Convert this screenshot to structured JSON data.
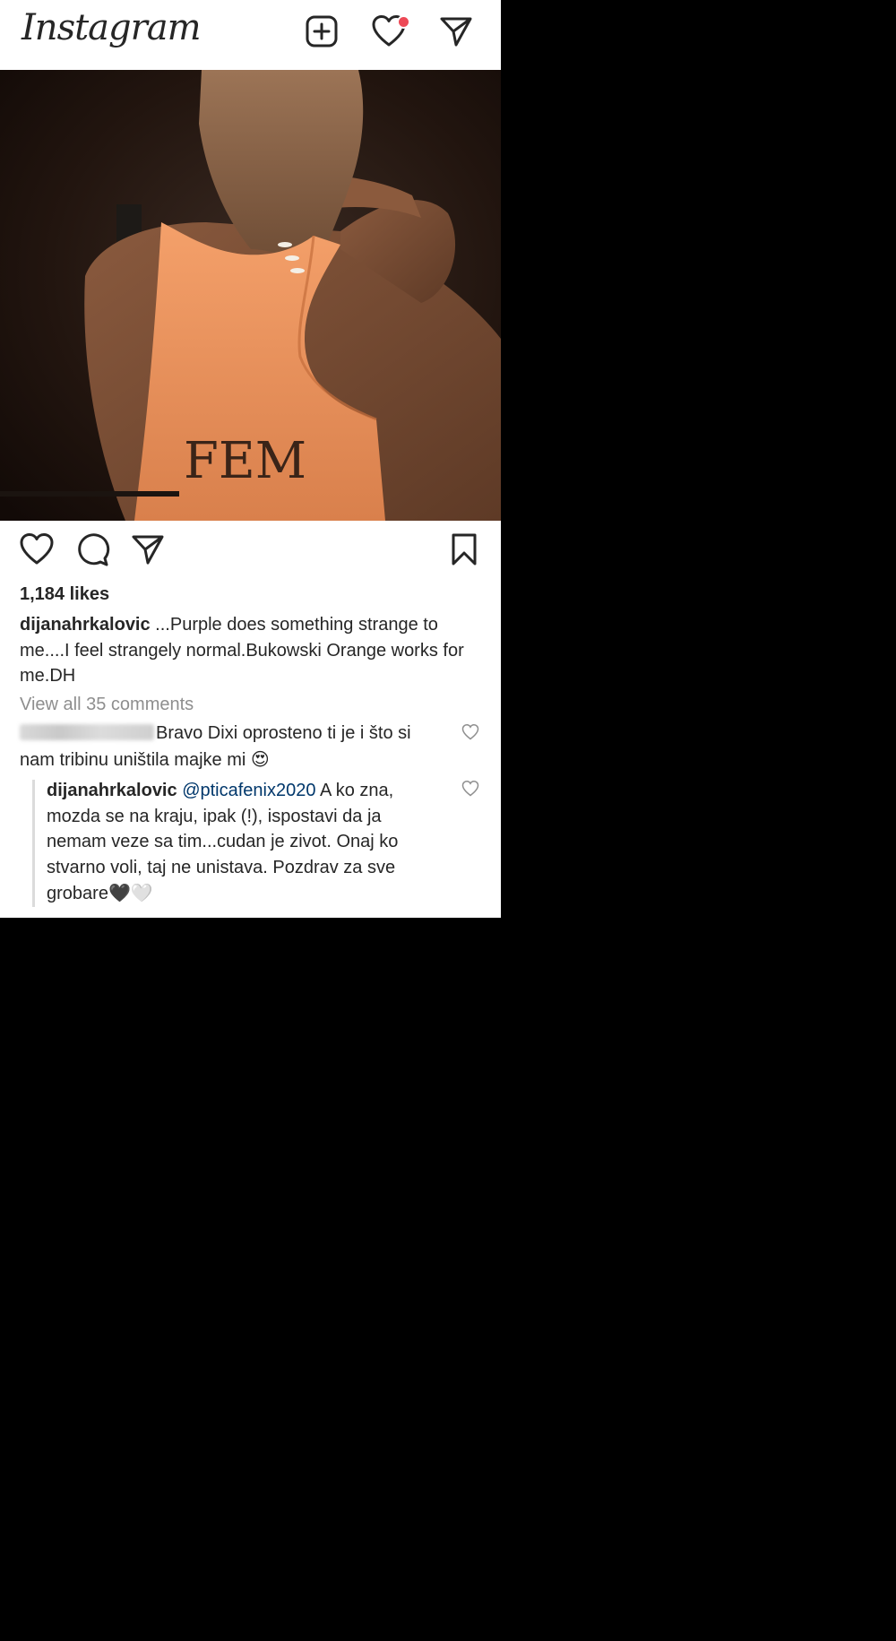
{
  "header": {
    "logo": "Instagram",
    "new_post_icon": "plus-square-icon",
    "activity_icon": "heart-icon",
    "direct_icon": "paper-plane-icon"
  },
  "post": {
    "image_icon": "photo-of-woman-in-orange-tank-top",
    "shirt_text": "FEM",
    "likes": "1,184 likes",
    "caption_user": "dijanahrkalovic",
    "caption_text": " ...Purple does something strange to me....I feel strangely normal.Bukowski  Orange works for me.DH",
    "view_all": "View all 35 comments"
  },
  "actions": {
    "like_icon": "heart-icon",
    "comment_icon": "comment-icon",
    "share_icon": "paper-plane-icon",
    "save_icon": "bookmark-icon"
  },
  "comments": [
    {
      "user": "pticafenix2020",
      "text": "Bravo Dixi oprosteno ti je i što si nam tribinu uništila majke mi ",
      "emoji": "😍"
    }
  ],
  "reply": {
    "user": "dijanahrkalovic",
    "mention": "@pticafenix2020",
    "text": " A ko zna, mozda se na kraju, ipak (!), ispostavi da ja nemam veze sa tim...cudan je zivot. Onaj ko stvarno voli, taj ne unistava. Pozdrav za sve grobare",
    "emoji_black": "🖤",
    "emoji_white": "🤍"
  },
  "colors": {
    "text": "#262626",
    "muted": "#8e8e8e",
    "link": "#00376b",
    "notification": "#ed4956",
    "shirt": "#f0965a"
  }
}
